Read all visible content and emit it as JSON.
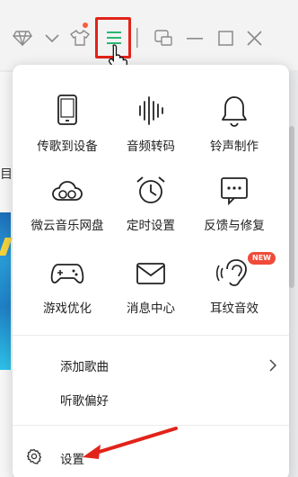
{
  "titlebar": {
    "icons": [
      "diamond-icon",
      "chevron-down-icon",
      "tshirt-icon",
      "menu-icon",
      "miniplayer-icon",
      "minimize-icon",
      "maximize-icon",
      "close-icon"
    ],
    "accent": "#2bb673",
    "highlight_color": "#e2231a"
  },
  "background": {
    "partial_char": "目"
  },
  "menu": {
    "grid": [
      {
        "label": "传歌到设备",
        "icon": "phone-icon"
      },
      {
        "label": "音频转码",
        "icon": "waveform-icon"
      },
      {
        "label": "铃声制作",
        "icon": "bell-icon"
      },
      {
        "label": "微云音乐网盘",
        "icon": "cloud-icon"
      },
      {
        "label": "定时设置",
        "icon": "alarm-clock-icon"
      },
      {
        "label": "反馈与修复",
        "icon": "feedback-icon"
      },
      {
        "label": "游戏优化",
        "icon": "gamepad-icon"
      },
      {
        "label": "消息中心",
        "icon": "mail-icon"
      },
      {
        "label": "耳纹音效",
        "icon": "ear-icon",
        "badge": "NEW"
      }
    ],
    "list": [
      {
        "label": "添加歌曲",
        "has_submenu": true
      },
      {
        "label": "听歌偏好"
      }
    ],
    "settings": {
      "label": "设置",
      "icon": "gear-icon"
    }
  }
}
